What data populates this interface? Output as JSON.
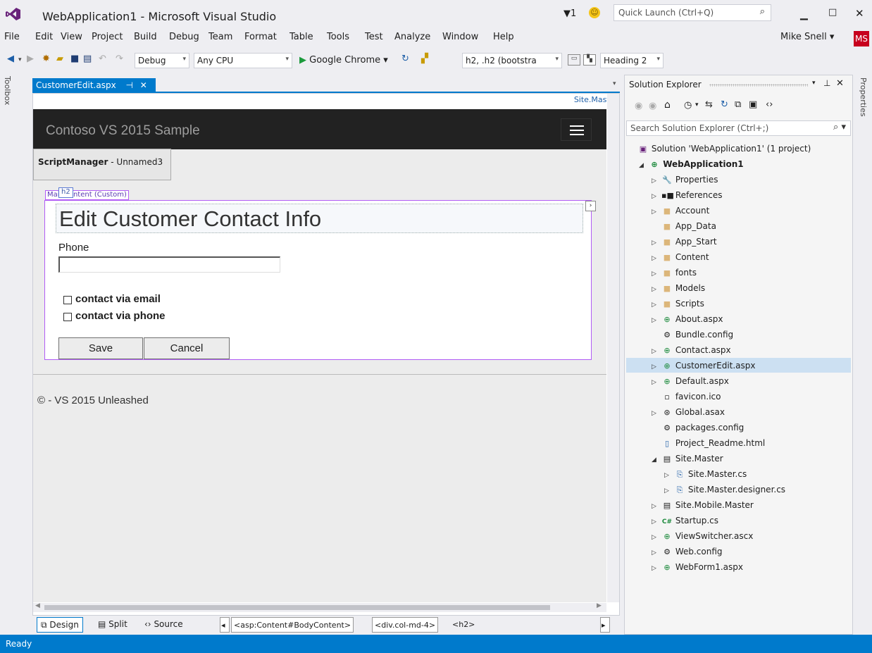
{
  "window": {
    "title": "WebApplication1 - Microsoft Visual Studio",
    "notif_count": "1",
    "quick_launch_placeholder": "Quick Launch (Ctrl+Q)"
  },
  "menu": [
    "File",
    "Edit",
    "View",
    "Project",
    "Build",
    "Debug",
    "Team",
    "Format",
    "Table",
    "Tools",
    "Test",
    "Analyze",
    "Window",
    "Help"
  ],
  "user": {
    "name": "Mike Snell",
    "initials": "MS"
  },
  "toolbar": {
    "config": "Debug",
    "platform": "Any CPU",
    "run_target": "Google Chrome",
    "css_rule": "h2, .h2 (bootstra",
    "block_format": "Heading 2"
  },
  "side_labels": {
    "toolbox": "Toolbox",
    "properties": "Properties"
  },
  "doc_tab": {
    "name": "CustomerEdit.aspx",
    "pin": "↕",
    "close": "✕",
    "master_link": "Site.Master"
  },
  "page": {
    "brand": "Contoso VS 2015 Sample",
    "script_manager_bold": "ScriptManager",
    "script_manager_rest": " - Unnamed3",
    "content_label": "MainContent (Custom)",
    "h2_tag": "h2",
    "heading": "Edit Customer Contact Info",
    "phone_label": "Phone",
    "phone_value": "",
    "check_email": "contact via email",
    "check_phone": "contact via phone",
    "save": "Save",
    "cancel": "Cancel",
    "footer": "© - VS 2015 Unleashed"
  },
  "views": {
    "design": "Design",
    "split": "Split",
    "source": "Source"
  },
  "breadcrumb": [
    "<asp:Content#BodyContent>",
    "<div.col-md-4>",
    "<h2>"
  ],
  "solution_explorer": {
    "title": "Solution Explorer",
    "search_placeholder": "Search Solution Explorer (Ctrl+;)",
    "items": [
      {
        "label": "Solution 'WebApplication1' (1 project)",
        "icon": "solution-icon",
        "bold": false
      },
      {
        "label": "WebApplication1",
        "icon": "web-project-icon",
        "bold": true
      },
      {
        "label": "Properties",
        "icon": "wrench-icon"
      },
      {
        "label": "References",
        "icon": "references-icon"
      },
      {
        "label": "Account",
        "icon": "folder-icon"
      },
      {
        "label": "App_Data",
        "icon": "folder-icon"
      },
      {
        "label": "App_Start",
        "icon": "folder-icon"
      },
      {
        "label": "Content",
        "icon": "folder-icon"
      },
      {
        "label": "fonts",
        "icon": "folder-icon"
      },
      {
        "label": "Models",
        "icon": "folder-icon"
      },
      {
        "label": "Scripts",
        "icon": "folder-icon"
      },
      {
        "label": "About.aspx",
        "icon": "web-form-icon"
      },
      {
        "label": "Bundle.config",
        "icon": "config-icon"
      },
      {
        "label": "Contact.aspx",
        "icon": "web-form-icon"
      },
      {
        "label": "CustomerEdit.aspx",
        "icon": "web-form-icon"
      },
      {
        "label": "Default.aspx",
        "icon": "web-form-icon"
      },
      {
        "label": "favicon.ico",
        "icon": "icon-file-icon"
      },
      {
        "label": "Global.asax",
        "icon": "asax-icon"
      },
      {
        "label": "packages.config",
        "icon": "config-icon"
      },
      {
        "label": "Project_Readme.html",
        "icon": "html-file-icon"
      },
      {
        "label": "Site.Master",
        "icon": "master-page-icon"
      },
      {
        "label": "Site.Master.cs",
        "icon": "cs-file-icon"
      },
      {
        "label": "Site.Master.designer.cs",
        "icon": "cs-file-icon"
      },
      {
        "label": "Site.Mobile.Master",
        "icon": "master-page-icon"
      },
      {
        "label": "Startup.cs",
        "icon": "csharp-icon"
      },
      {
        "label": "ViewSwitcher.ascx",
        "icon": "user-control-icon"
      },
      {
        "label": "Web.config",
        "icon": "config-icon"
      },
      {
        "label": "WebForm1.aspx",
        "icon": "web-form-icon"
      }
    ]
  },
  "status": {
    "text": "Ready"
  },
  "colors": {
    "accent": "#007acc",
    "selection": "#b15cf5",
    "folder": "#dcb67a"
  }
}
